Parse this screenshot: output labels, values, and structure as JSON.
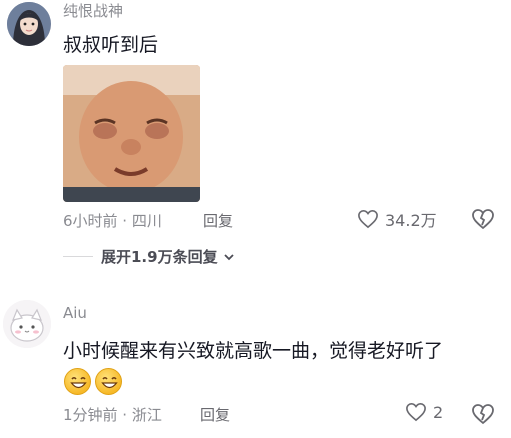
{
  "comments": [
    {
      "username": "纯恨战神",
      "text": "叔叔听到后",
      "meta": "6小时前 · 四川",
      "reply_label": "回复",
      "likes": "34.2万",
      "expand_label": "展开1.9万条回复"
    },
    {
      "username": "Aiu",
      "text": "小时候醒来有兴致就高歌一曲，觉得老好听了",
      "meta": "1分钟前 · 浙江",
      "reply_label": "回复",
      "likes": "2"
    }
  ],
  "icons": {
    "like": "heart-outline-icon",
    "dislike": "broken-heart-icon",
    "expand": "chevron-down-icon",
    "emoji": "grinning-face-emoji"
  }
}
